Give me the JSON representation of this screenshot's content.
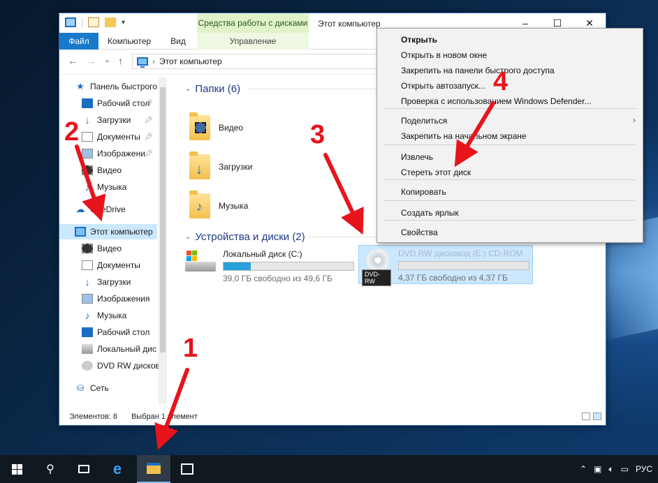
{
  "window": {
    "title": "Этот компьютер",
    "context_tab_header": "Средства работы с дисками",
    "controls": {
      "minimize": "–",
      "maximize": "☐",
      "close": "✕"
    }
  },
  "ribbon": {
    "tabs": [
      "Файл",
      "Компьютер",
      "Вид",
      "Управление"
    ]
  },
  "address": {
    "back": "←",
    "forward": "→",
    "history": "⌄",
    "up": "↑",
    "path": "Этот компьютер"
  },
  "navpane": {
    "items": [
      {
        "label": "Панель быстрого",
        "icon": "star-icon"
      },
      {
        "label": "Рабочий стол",
        "icon": "desktop-icon",
        "pinned": true
      },
      {
        "label": "Загрузки",
        "icon": "download-icon",
        "pinned": true
      },
      {
        "label": "Документы",
        "icon": "document-icon",
        "pinned": true
      },
      {
        "label": "Изображени",
        "icon": "pictures-icon",
        "pinned": true
      },
      {
        "label": "Видео",
        "icon": "video-icon"
      },
      {
        "label": "Музыка",
        "icon": "music-icon"
      },
      {
        "label": "OneDrive",
        "icon": "cloud-icon"
      },
      {
        "label": "Этот компьютер",
        "icon": "computer-icon",
        "selected": true
      },
      {
        "label": "Видео",
        "icon": "video-icon"
      },
      {
        "label": "Документы",
        "icon": "document-icon"
      },
      {
        "label": "Загрузки",
        "icon": "download-icon"
      },
      {
        "label": "Изображения",
        "icon": "pictures-icon"
      },
      {
        "label": "Музыка",
        "icon": "music-icon"
      },
      {
        "label": "Рабочий стол",
        "icon": "desktop-icon"
      },
      {
        "label": "Локальный дис",
        "icon": "drive-icon"
      },
      {
        "label": "DVD RW дисков",
        "icon": "dvd-icon"
      },
      {
        "label": "Сеть",
        "icon": "network-icon"
      }
    ]
  },
  "content": {
    "folders_header": "Папки (6)",
    "folders": [
      "Видео",
      "Загрузки",
      "Музыка"
    ],
    "devices_header": "Устройства и диски (2)",
    "drives": [
      {
        "name": "Локальный диск (C:)",
        "free": "39,0 ГБ свободно из 49,6 ГБ",
        "used_fraction": 0.21
      },
      {
        "name": "DVD RW дисковод (E:) CD-ROM",
        "badge": "DVD-RW",
        "free": "4,37 ГБ свободно из 4,37 ГБ",
        "used_fraction": 0.0
      }
    ]
  },
  "statusbar": {
    "count": "Элементов: 8",
    "selection": "Выбран 1 элемент"
  },
  "context_menu": {
    "items": [
      {
        "label": "Открыть",
        "bold": true
      },
      {
        "label": "Открыть в новом окне"
      },
      {
        "label": "Закрепить на панели быстрого доступа"
      },
      {
        "label": "Открыть автозапуск..."
      },
      {
        "label": "Проверка с использованием Windows Defender..."
      },
      {
        "label": "Поделиться",
        "submenu": true
      },
      {
        "label": "Закрепить на начальном экране"
      },
      {
        "label": "Извлечь"
      },
      {
        "label": "Стереть этот диск"
      },
      {
        "label": "Копировать"
      },
      {
        "label": "Создать ярлык"
      },
      {
        "label": "Свойства"
      }
    ]
  },
  "annotations": [
    "1",
    "2",
    "3",
    "4"
  ],
  "taskbar": {
    "items": [
      "start-icon",
      "search-icon",
      "task-view-icon",
      "edge-icon",
      "explorer-icon",
      "store-icon"
    ],
    "tray_lang": "РУС"
  },
  "colors": {
    "accent": "#1979ca",
    "annotation": "#e8141b",
    "selection": "#cce8ff",
    "context_tab": "#e0f2c9"
  }
}
